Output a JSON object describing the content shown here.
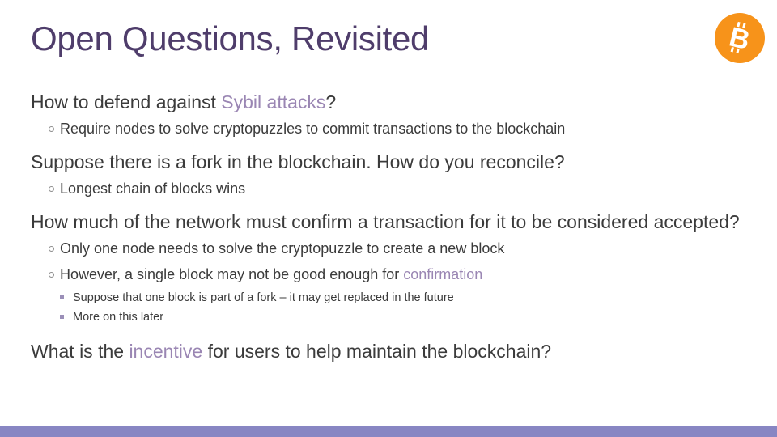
{
  "slide": {
    "title": "Open Questions, Revisited",
    "logo_icon": "bitcoin-icon",
    "colors": {
      "title": "#4f3d6b",
      "highlight": "#9a86b3",
      "bottom_bar": "#8886c3",
      "logo": "#f7931a"
    }
  },
  "questions": [
    {
      "text_before": "How to defend against ",
      "highlight": "Sybil attacks",
      "text_after": "?",
      "points": [
        {
          "text": "Require nodes to solve cryptopuzzles to commit transactions to the blockchain"
        }
      ]
    },
    {
      "text": "Suppose there is a fork in the blockchain. How do you reconcile?",
      "points": [
        {
          "text": "Longest chain of blocks wins"
        }
      ]
    },
    {
      "text": "How much of the network must confirm a transaction for it to be considered accepted?",
      "points": [
        {
          "text": "Only one node needs to solve the cryptopuzzle to create a new block"
        },
        {
          "text_before": "However, a single block may not be good enough for ",
          "highlight": "confirmation",
          "subpoints": [
            "Suppose that one block is part of a fork – it may get replaced in the future",
            "More on this later"
          ]
        }
      ]
    },
    {
      "text_before": "What is the ",
      "highlight": "incentive",
      "text_after": " for users to help maintain the blockchain?"
    }
  ]
}
